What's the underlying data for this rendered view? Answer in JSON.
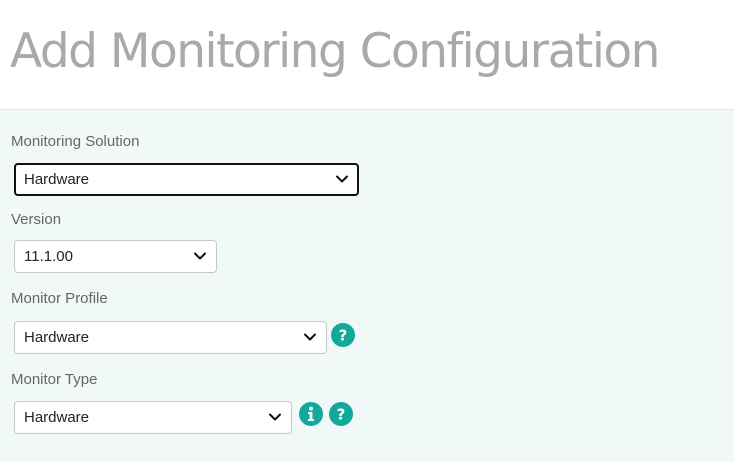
{
  "page": {
    "title": "Add Monitoring Configuration"
  },
  "form": {
    "monitoring_solution": {
      "label": "Monitoring Solution",
      "value": "Hardware"
    },
    "version": {
      "label": "Version",
      "value": "11.1.00"
    },
    "monitor_profile": {
      "label": "Monitor Profile",
      "value": "Hardware",
      "help_icon": "help-icon"
    },
    "monitor_type": {
      "label": "Monitor Type",
      "value": "Hardware",
      "info_icon": "info-icon",
      "help_icon": "help-icon"
    }
  },
  "colors": {
    "accent": "#12a89a",
    "panel_background": "#f1f8f8",
    "title": "#a9a9a9",
    "label": "#666666"
  }
}
